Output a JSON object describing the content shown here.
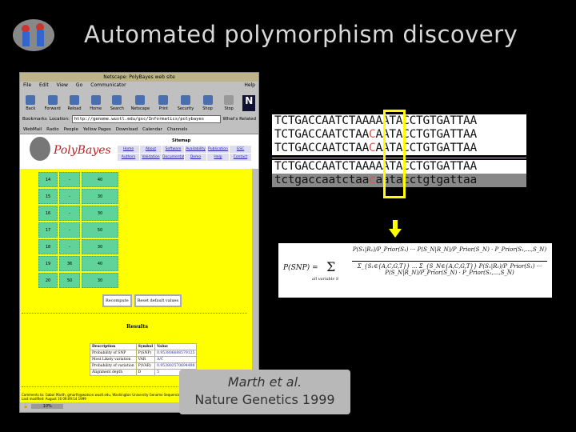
{
  "slide": {
    "title": "Automated polymorphism discovery"
  },
  "browser": {
    "window_title": "Netscape: PolyBayes web site",
    "menu": [
      "File",
      "Edit",
      "View",
      "Go",
      "Communicator",
      "Help"
    ],
    "toolbar": [
      "Back",
      "Forward",
      "Reload",
      "Home",
      "Search",
      "Netscape",
      "Print",
      "Security",
      "Shop",
      "Stop"
    ],
    "bookmarks_label": "Bookmarks",
    "location_label": "Location:",
    "url": "http://genome.wustl.edu/gsc/Informatics/polybayes",
    "whats_related": "What's Related",
    "personal": [
      "WebMail",
      "Radio",
      "People",
      "Yellow Pages",
      "Download",
      "Calendar",
      "Channels"
    ],
    "logo": "PolyBayes",
    "sitemap": "Sitemap",
    "nav": [
      "Home",
      "About",
      "Software",
      "Availability",
      "Publication",
      "GSC Contacts",
      "Authors",
      "Validation",
      "Documentation",
      "Demo",
      "Help",
      "Contact"
    ],
    "rows": [
      {
        "n": "14",
        "a": "-",
        "b": "40"
      },
      {
        "n": "15",
        "a": "-",
        "b": "30"
      },
      {
        "n": "16",
        "a": "-",
        "b": "30"
      },
      {
        "n": "17",
        "a": "-",
        "b": "50"
      },
      {
        "n": "18",
        "a": "-",
        "b": "30"
      },
      {
        "n": "19",
        "a": "36",
        "b": "40"
      },
      {
        "n": "20",
        "a": "50",
        "b": "30"
      }
    ],
    "buttons": [
      "Recompute",
      "Reset default values"
    ],
    "results_title": "Results",
    "results": [
      [
        "Description",
        "Symbol",
        "Value"
      ],
      [
        "Probability of SNP",
        "P(SNP)",
        "0.953806688579125"
      ],
      [
        "Most Likely variation",
        "VAR",
        "A/C"
      ],
      [
        "Probability of variation",
        "P(VAR)",
        "0.953802570694498"
      ],
      [
        "Alignment depth",
        "D",
        "5"
      ]
    ],
    "footer1": "Comments to: Gabor Marth, gmarth@watson.wustl.edu, Washington University Genome Sequencing Center",
    "footer2": "Last modified: August 16 09:09:14 1999",
    "status": "10%"
  },
  "alignment": {
    "snp_index": 14,
    "rows": [
      {
        "pre": "TCTGACCAATCTAA",
        "snp": "A",
        "post": "AATACCTGTGATTAA"
      },
      {
        "pre": "TCTGACCAATCTAA",
        "snp": "C",
        "post": "AATACCTGTGATTAA"
      },
      {
        "pre": "TCTGACCAATCTAA",
        "snp": "C",
        "post": "AATACCTGTGATTAA"
      }
    ],
    "ref": {
      "pre": "TCTGACCAATCTAA",
      "snp": "A",
      "post": "AATACCTGTGATTAA"
    },
    "consensus": {
      "pre": "tctgaccaatctaa",
      "snp": "c",
      "post": "aatacctgtgattaa"
    }
  },
  "formula": {
    "lhs": "P(SNP) =",
    "sum": "Σ",
    "sum_sub": "all variable S",
    "num": "P(S₁|R₁)/P_Prior(S₁) ··· P(S_N|R_N)/P_Prior(S_N) · P_Prior(S₁,...,S_N)",
    "den": "Σ_{S₁∈{A,C,G,T}} ... Σ_{S_N∈{A,C,G,T}} P(S₁|R₁)/P_Prior(S₁) ··· P(S_N|R_N)/P_Prior(S_N) · P_Prior(S₁,...,S_N)"
  },
  "citation": {
    "line1": "Marth et al.",
    "line2": "Nature Genetics 1999"
  },
  "colors": {
    "highlight": "#ffff00",
    "page_bg": "#ffff00",
    "cell": "#5fd39a",
    "snp": "#e05050"
  }
}
